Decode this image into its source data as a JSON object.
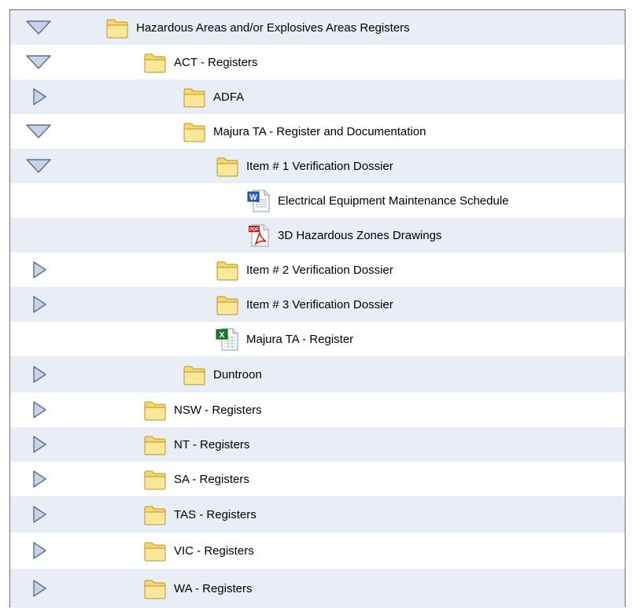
{
  "tree": {
    "rows": [
      {
        "label": "Hazardous Areas and/or Explosives Areas Registers",
        "icon": "folder-icon",
        "state": "expanded"
      },
      {
        "label": "ACT -  Registers",
        "icon": "folder-icon",
        "state": "expanded"
      },
      {
        "label": "ADFA",
        "icon": "folder-icon",
        "state": "collapsed"
      },
      {
        "label": "Majura TA -  Register and Documentation",
        "icon": "folder-icon",
        "state": "expanded"
      },
      {
        "label": "Item # 1 Verification Dossier",
        "icon": "folder-icon",
        "state": "expanded"
      },
      {
        "label": "Electrical Equipment Maintenance Schedule",
        "icon": "word-document-icon",
        "state": "leaf"
      },
      {
        "label": "3D Hazardous Zones Drawings",
        "icon": "pdf-document-icon",
        "state": "leaf"
      },
      {
        "label": "Item # 2 Verification Dossier",
        "icon": "folder-icon",
        "state": "collapsed"
      },
      {
        "label": "Item # 3 Verification Dossier",
        "icon": "folder-icon",
        "state": "collapsed"
      },
      {
        "label": "Majura TA -  Register",
        "icon": "excel-spreadsheet-icon",
        "state": "leaf"
      },
      {
        "label": "Duntroon",
        "icon": "folder-icon",
        "state": "collapsed"
      },
      {
        "label": "NSW -  Registers",
        "icon": "folder-icon",
        "state": "collapsed"
      },
      {
        "label": "NT -  Registers",
        "icon": "folder-icon",
        "state": "collapsed"
      },
      {
        "label": "SA -  Registers",
        "icon": "folder-icon",
        "state": "collapsed"
      },
      {
        "label": "TAS -  Registers",
        "icon": "folder-icon",
        "state": "collapsed"
      },
      {
        "label": "VIC -  Registers",
        "icon": "folder-icon",
        "state": "collapsed"
      },
      {
        "label": "WA -  Registers",
        "icon": "folder-icon",
        "state": "collapsed"
      }
    ]
  },
  "colors": {
    "row_shade": "#e9edf5",
    "toggle_fill": "#c9d3e6",
    "toggle_stroke": "#5b6f93",
    "folder_fill": "#f6d76a",
    "folder_stroke": "#b9962a",
    "border": "#6f6f6f"
  }
}
